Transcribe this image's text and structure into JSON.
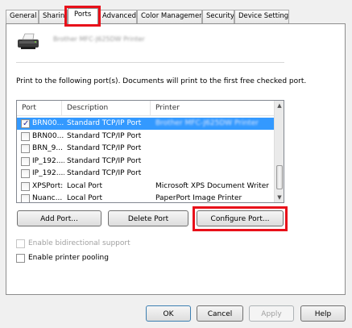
{
  "tabs": [
    "General",
    "Sharing",
    "Ports",
    "Advanced",
    "Color Management",
    "Security",
    "Device Settings"
  ],
  "printer_name": "Brother MFC-J625DW Printer",
  "instructions": "Print to the following port(s). Documents will print to the first free checked port.",
  "columns": [
    "Port",
    "Description",
    "Printer"
  ],
  "ports": [
    {
      "port": "BRN00...",
      "description": "Standard TCP/IP Port",
      "printer": "Brother MFC-J625DW Printer",
      "checked": true,
      "selected": true
    },
    {
      "port": "BRN00...",
      "description": "Standard TCP/IP Port",
      "printer": "",
      "checked": false,
      "selected": false
    },
    {
      "port": "BRN_9...",
      "description": "Standard TCP/IP Port",
      "printer": "",
      "checked": false,
      "selected": false
    },
    {
      "port": "IP_192....",
      "description": "Standard TCP/IP Port",
      "printer": "",
      "checked": false,
      "selected": false
    },
    {
      "port": "IP_192....",
      "description": "Standard TCP/IP Port",
      "printer": "",
      "checked": false,
      "selected": false
    },
    {
      "port": "XPSPort:",
      "description": "Local Port",
      "printer": "Microsoft XPS Document Writer",
      "checked": false,
      "selected": false
    },
    {
      "port": "Nuanc...",
      "description": "Local Port",
      "printer": "PaperPort Image Printer",
      "checked": false,
      "selected": false
    }
  ],
  "buttons": {
    "add_port": "Add Port...",
    "delete_port": "Delete Port",
    "configure_port": "Configure Port..."
  },
  "options": {
    "bidirectional": "Enable bidirectional support",
    "pooling": "Enable printer pooling"
  },
  "dialog_buttons": {
    "ok": "OK",
    "cancel": "Cancel",
    "apply": "Apply",
    "help": "Help"
  },
  "highlight_color": "#e8101a",
  "selection_color": "#3399ff"
}
